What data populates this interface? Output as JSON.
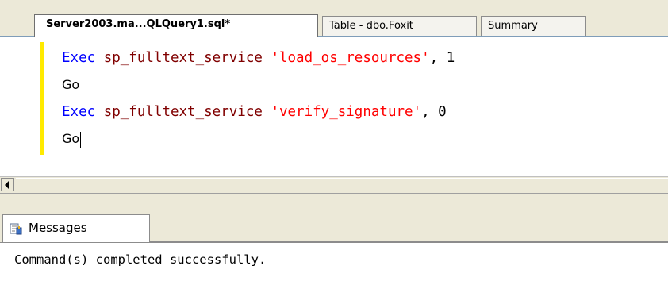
{
  "tabs": [
    {
      "label": "Server2003.ma...QLQuery1.sql*",
      "active": true
    },
    {
      "label": "Table - dbo.Foxit",
      "active": false
    },
    {
      "label": "Summary",
      "active": false
    }
  ],
  "editor": {
    "lines": [
      {
        "keyword": "Exec",
        "proc": "sp_fulltext_service",
        "string": "'load_os_resources'",
        "tail": ", 1"
      },
      {
        "text": "Go"
      },
      {
        "keyword": "Exec",
        "proc": "sp_fulltext_service",
        "string": "'verify_signature'",
        "tail": ", 0"
      },
      {
        "text": "Go"
      }
    ]
  },
  "results": {
    "tab_label": "Messages",
    "message": "Command(s) completed successfully."
  },
  "colors": {
    "keyword": "#0000ff",
    "procedure": "#800000",
    "string": "#ff0000",
    "change_bar": "#ffea00"
  }
}
